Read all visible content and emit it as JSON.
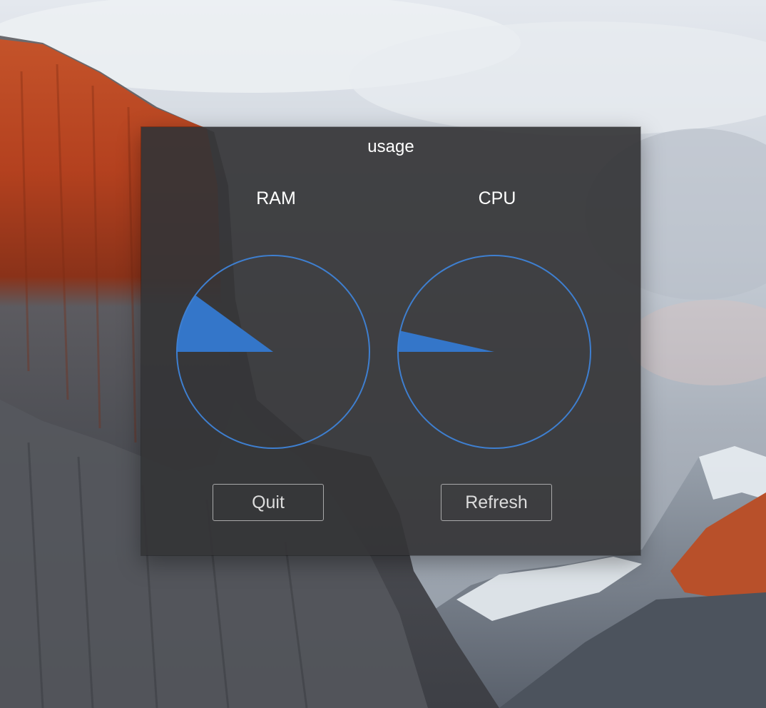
{
  "window": {
    "title": "usage"
  },
  "gauges": [
    {
      "label": "RAM",
      "value_fraction": 0.1
    },
    {
      "label": "CPU",
      "value_fraction": 0.035
    }
  ],
  "buttons": {
    "quit_label": "Quit",
    "refresh_label": "Refresh"
  },
  "colors": {
    "gauge_fill": "#3476c9",
    "gauge_ring": "#3e7fd0",
    "panel_bg": "#343436"
  }
}
